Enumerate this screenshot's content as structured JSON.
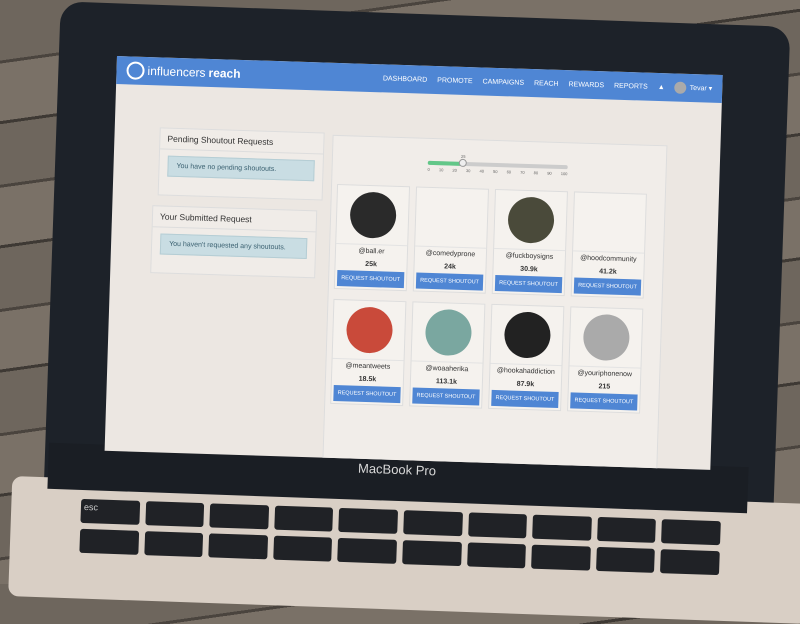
{
  "device": {
    "label": "MacBook Pro"
  },
  "nav": {
    "brand_light": "influencers",
    "brand_bold": "reach",
    "items": [
      "DASHBOARD",
      "PROMOTE",
      "CAMPAIGNS",
      "REACH",
      "REWARDS",
      "REPORTS"
    ],
    "user": "Tevar"
  },
  "pending": {
    "title": "Pending Shoutout Requests",
    "message": "You have no pending shoutouts."
  },
  "submitted": {
    "title": "Your Submitted Request",
    "message": "You haven't requested any shoutouts."
  },
  "slider": {
    "value": "25",
    "value_num": 25,
    "ticks": [
      "0",
      "10",
      "20",
      "30",
      "40",
      "50",
      "60",
      "70",
      "80",
      "90",
      "100"
    ]
  },
  "accounts": [
    {
      "handle": "@ball.er",
      "count": "25k",
      "color": "#2a2a2a"
    },
    {
      "handle": "@comedyprone",
      "count": "24k",
      "color": "#f5f2ee"
    },
    {
      "handle": "@fuckboysigns",
      "count": "30.9k",
      "color": "#4a4a3a"
    },
    {
      "handle": "@hoodcommunity",
      "count": "41.2k",
      "color": "#f5f2ee"
    },
    {
      "handle": "@meantweets",
      "count": "18.5k",
      "color": "#c94a3a"
    },
    {
      "handle": "@woaaherika",
      "count": "113.1k",
      "color": "#7aa7a0"
    },
    {
      "handle": "@hookahaddiction",
      "count": "87.9k",
      "color": "#222"
    },
    {
      "handle": "@youriphonenow",
      "count": "215",
      "color": "#aaa"
    }
  ],
  "button_label": "REQUEST SHOUTOUT",
  "keyboard": {
    "esc": "esc"
  }
}
